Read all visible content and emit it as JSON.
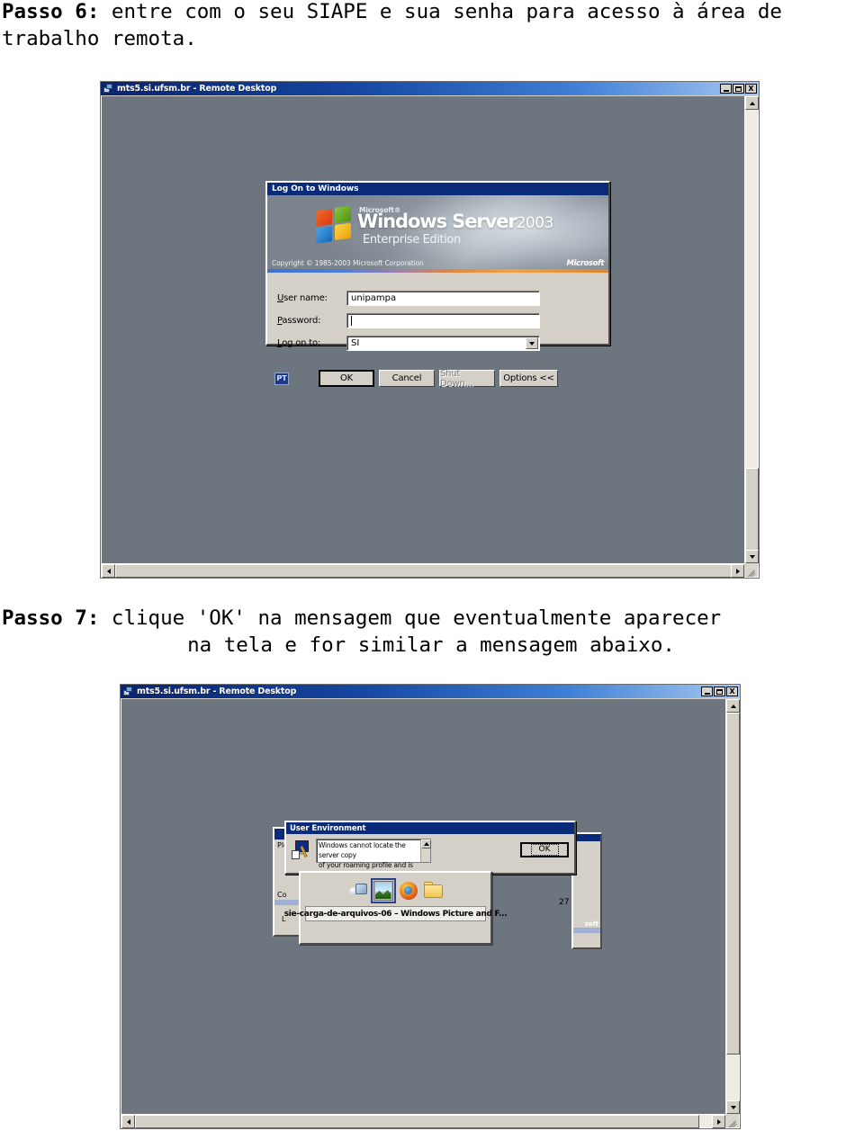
{
  "document": {
    "passo6": {
      "label": "Passo 6:",
      "text": " entre com o seu SIAPE e sua senha para acesso à área de trabalho remota."
    },
    "passo7": {
      "label": "Passo 7:",
      "line1": " clique 'OK' na mensagem que eventualmente aparecer",
      "line2": "na tela e for similar a mensagem abaixo.",
      "emphasis": "OK"
    }
  },
  "screenshot1": {
    "window": {
      "title": "mts5.si.ufsm.br - Remote Desktop",
      "icon": "remote-desktop-icon",
      "minimize": "_",
      "maximize": "□",
      "close": "X"
    },
    "logon_dialog": {
      "title": "Log On to Windows",
      "brand": {
        "microsoft_small": "Microsoft®",
        "product": "Windows Server",
        "year": "2003",
        "edition": "Enterprise Edition",
        "copyright": "Copyright © 1985-2003 Microsoft Corporation",
        "logo_text": "Microsoft"
      },
      "fields": [
        {
          "label_pre": "U",
          "label_rest": "ser name:",
          "value": "unipampa",
          "name": "username"
        },
        {
          "label_pre": "P",
          "label_rest": "assword:",
          "value": "",
          "name": "password"
        },
        {
          "label_pre": "L",
          "label_rest": "og on to:",
          "value": "SI",
          "name": "logonto"
        }
      ],
      "language_badge": "PT",
      "buttons": [
        {
          "label": "OK",
          "state": "default"
        },
        {
          "label": "Cancel",
          "state": "normal"
        },
        {
          "label": "Shut Down...",
          "state": "disabled"
        },
        {
          "label": "Options <<",
          "state": "normal"
        }
      ]
    }
  },
  "screenshot2": {
    "window": {
      "title": "mts5.si.ufsm.br - Remote Desktop",
      "icon": "remote-desktop-icon",
      "minimize": "_",
      "maximize": "□",
      "close": "X"
    },
    "background_window": {
      "line1": "Ple",
      "line2": "Co",
      "line3": "L",
      "right_fragment": "soft",
      "number_fragment": "27"
    },
    "user_environment_dialog": {
      "title": "User Environment",
      "icon": "user-environment-icon",
      "message_line1": "Windows cannot locate the server copy",
      "message_line2": "of your roaming profile and is attempting",
      "ok_label": "OK"
    },
    "task_switcher": {
      "icons": [
        {
          "name": "network-connection-icon",
          "selected": false
        },
        {
          "name": "picture-viewer-icon",
          "selected": true
        },
        {
          "name": "firefox-icon",
          "selected": false
        },
        {
          "name": "folder-icon",
          "selected": false
        }
      ],
      "caption": "sie-carga-de-arquivos-06 – Windows Picture and F..."
    }
  },
  "colors": {
    "titlebar_blue": "#0a246a",
    "dialog_titlebar": "#0a2a7a",
    "desktop_gray": "#6d757f",
    "face": "#d4d0c8",
    "selection_blue": "#27418c"
  }
}
